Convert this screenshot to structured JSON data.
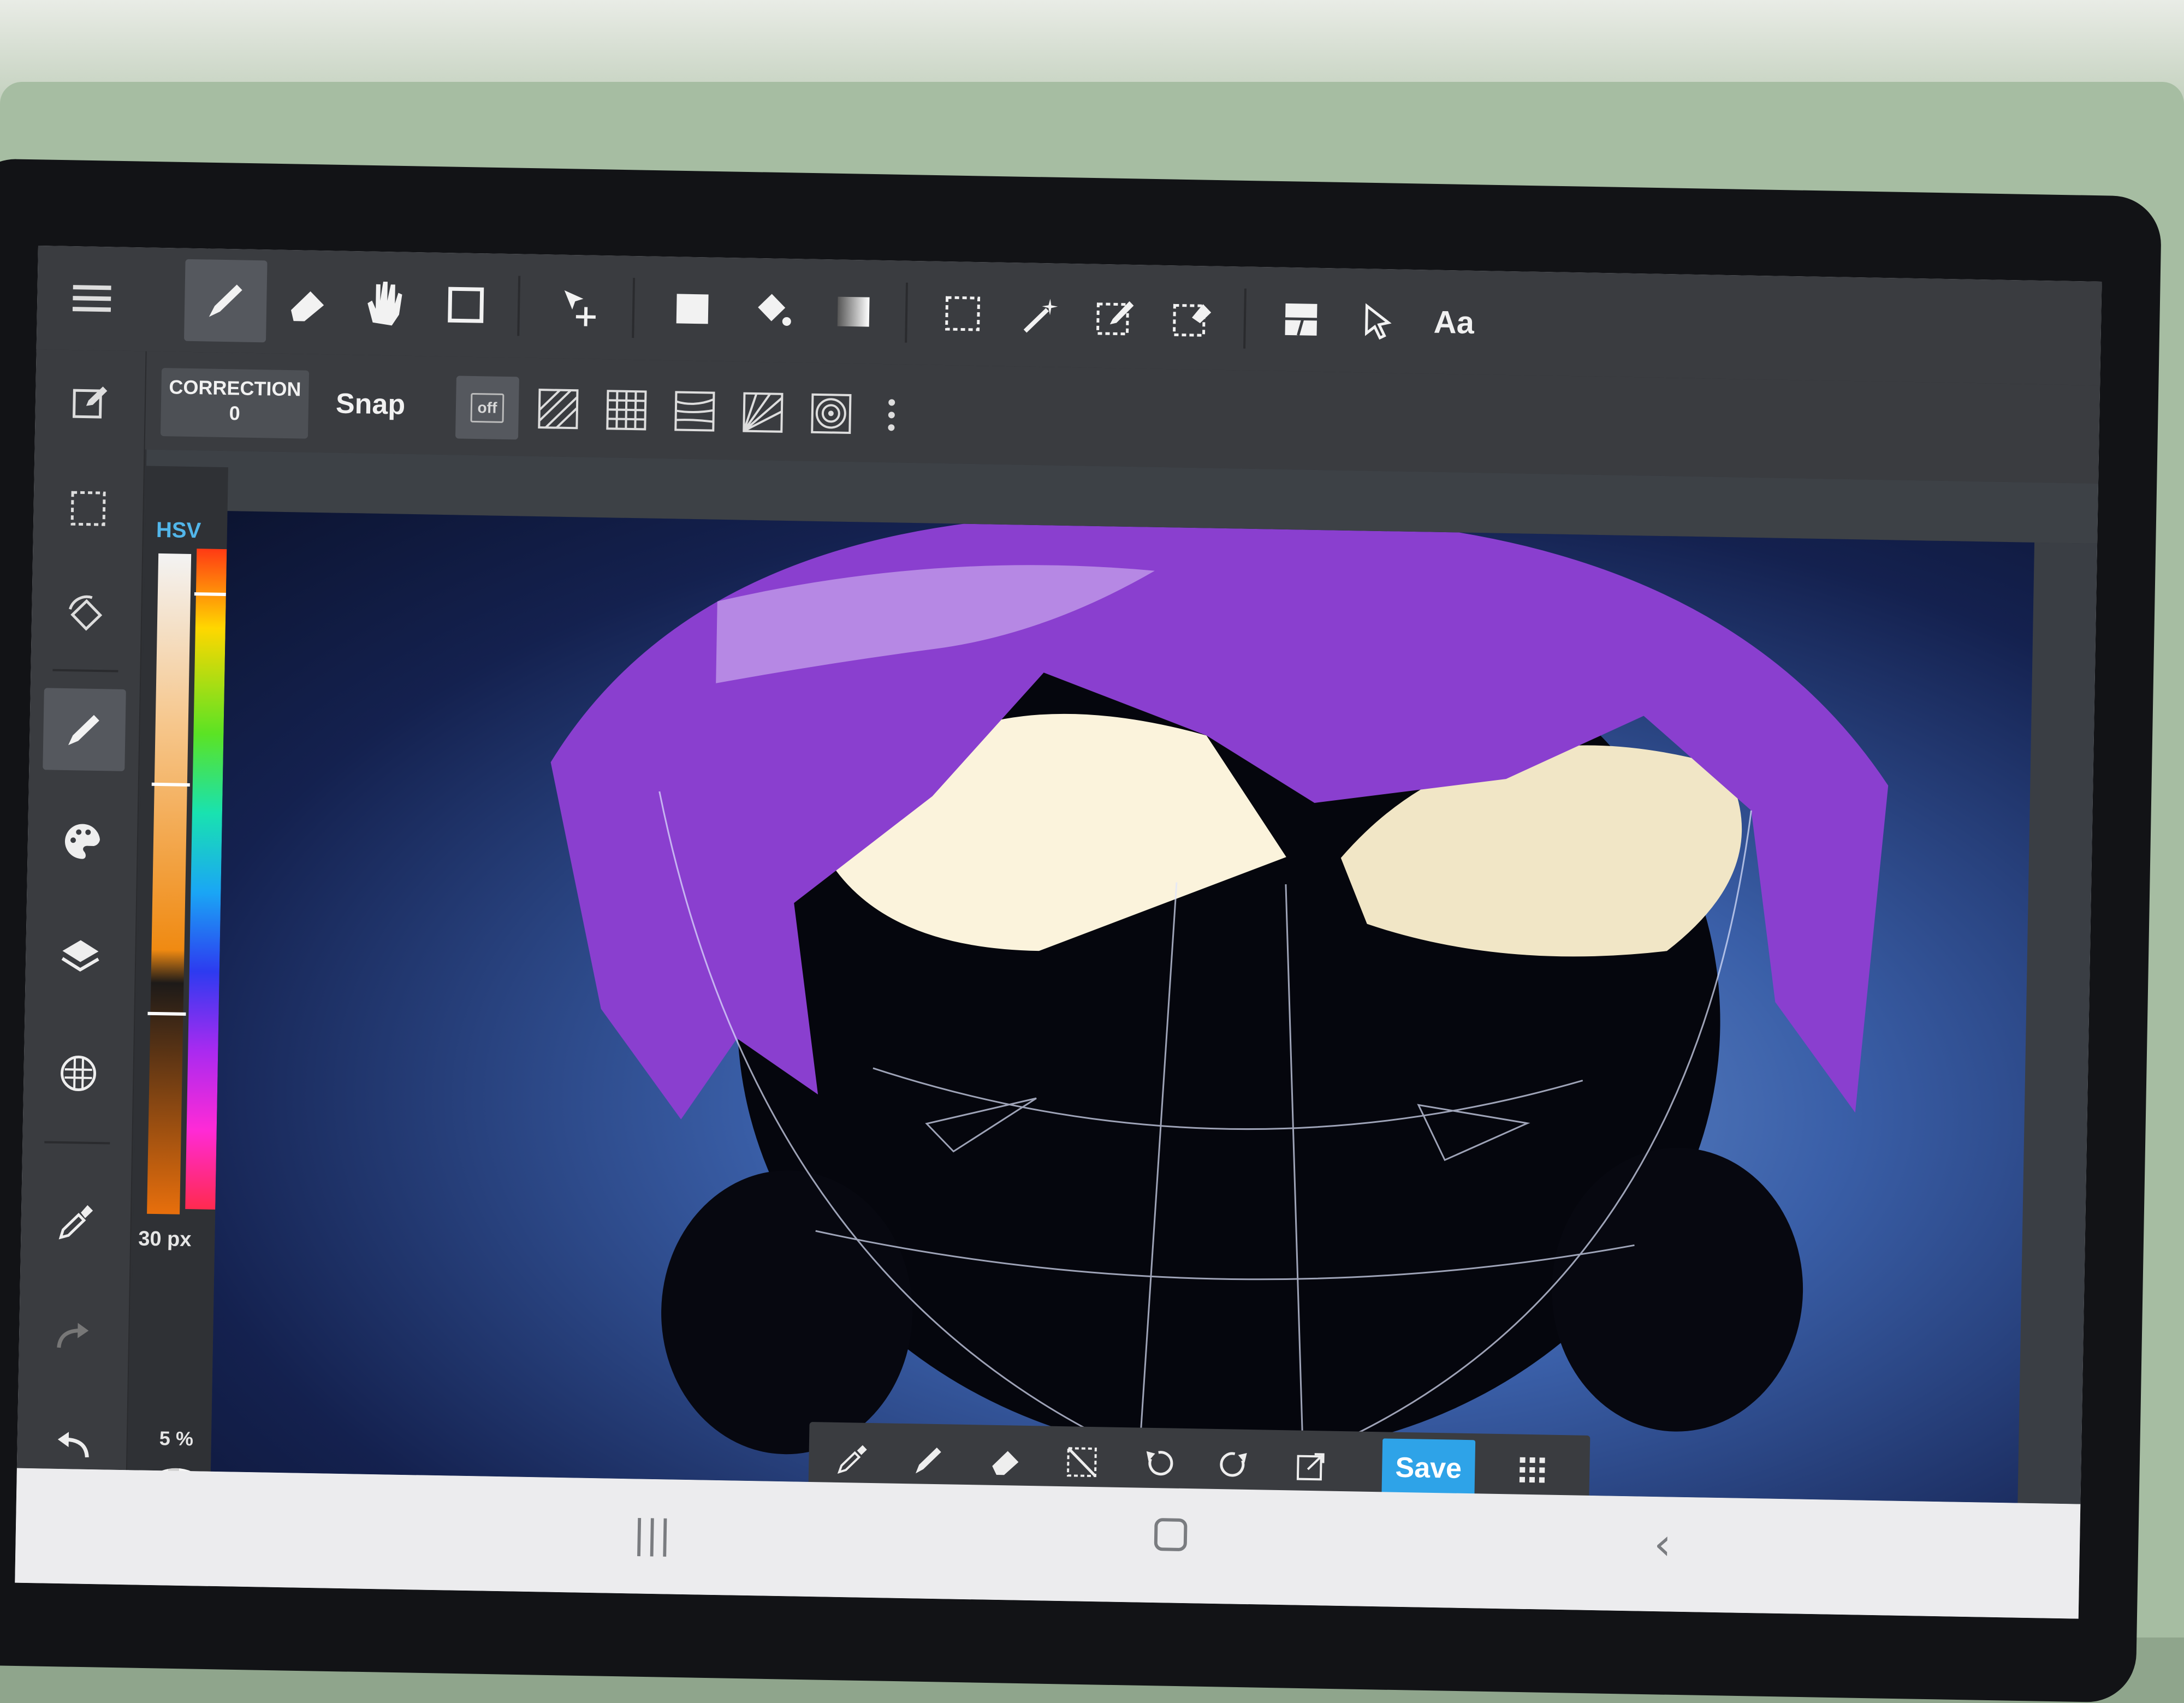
{
  "toolbar": {
    "text_tool_label": "Aa"
  },
  "sub_toolbar": {
    "correction_label": "CORRECTION",
    "correction_value": "0",
    "snap_label": "Snap",
    "snap_off_label": "off"
  },
  "color_panel": {
    "tab_label": "HSV",
    "brush_size": "30 px",
    "opacity": "5 %"
  },
  "floating_bar": {
    "save_label": "Save"
  },
  "colors": {
    "accent": "#2ea3e8",
    "hsv_tab": "#52b6ea",
    "toolbar_bg": "#3a3c40"
  },
  "icons": {
    "top_toolbar": [
      "pencil-icon",
      "eraser-icon",
      "hand-icon",
      "rectangle-icon",
      "move-icon",
      "fill-rect-icon",
      "bucket-icon",
      "gradient-icon",
      "select-rect-icon",
      "magic-wand-icon",
      "select-pen-icon",
      "select-eraser-icon",
      "frame-divider-icon",
      "pointer-icon",
      "text-icon"
    ],
    "left_sidebar": [
      "menu-icon",
      "edit-icon",
      "selection-icon",
      "rotate-icon",
      "brush-icon",
      "palette-icon",
      "layers-icon",
      "materials-icon",
      "eyedropper-icon",
      "redo-icon",
      "undo-icon"
    ],
    "floating_bar": [
      "eyedropper-icon",
      "pen-icon",
      "eraser-icon",
      "deselect-icon",
      "undo-icon",
      "redo-icon",
      "export-icon",
      "grid-icon"
    ]
  }
}
